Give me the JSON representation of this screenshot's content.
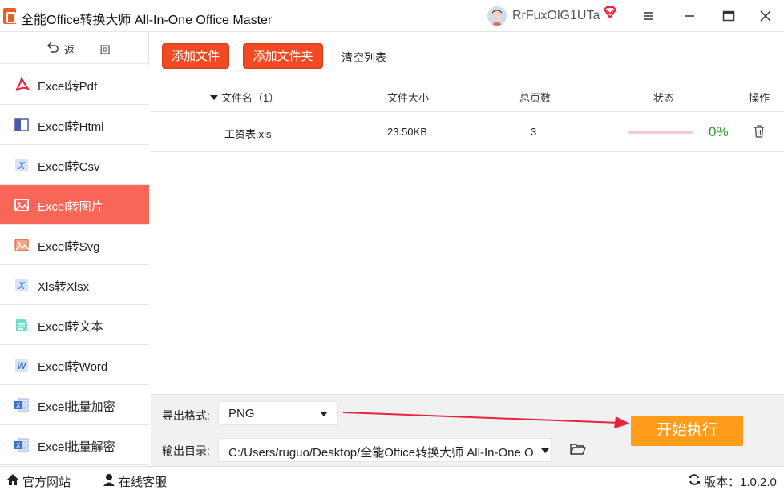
{
  "app": {
    "title": "全能Office转换大师 All-In-One Office Master",
    "user_name": "RrFuxOlG1UTa"
  },
  "colors": {
    "accent": "#f04a22",
    "sidebar_active": "#f86658",
    "start_button": "#ff9c1a",
    "progress_text": "#2a9d2a",
    "progress_track": "#f6c7d4"
  },
  "sidebar": {
    "back_label": "返 回",
    "items": [
      {
        "label": "Excel转Pdf",
        "icon": "pdf-icon",
        "active": false
      },
      {
        "label": "Excel转Html",
        "icon": "html-icon",
        "active": false
      },
      {
        "label": "Excel转Csv",
        "icon": "csv-icon",
        "active": false
      },
      {
        "label": "Excel转图片",
        "icon": "image-icon",
        "active": true
      },
      {
        "label": "Excel转Svg",
        "icon": "svg-image-icon",
        "active": false
      },
      {
        "label": "Xls转Xlsx",
        "icon": "xlsx-icon",
        "active": false
      },
      {
        "label": "Excel转文本",
        "icon": "text-file-icon",
        "active": false
      },
      {
        "label": "Excel转Word",
        "icon": "word-icon",
        "active": false
      },
      {
        "label": "Excel批量加密",
        "icon": "excel-lock-icon",
        "active": false
      },
      {
        "label": "Excel批量解密",
        "icon": "excel-unlock-icon",
        "active": false
      }
    ]
  },
  "toolbar": {
    "add_file": "添加文件",
    "add_folder": "添加文件夹",
    "clear_list": "清空列表"
  },
  "table": {
    "columns": [
      "文件名（1）",
      "文件大小",
      "总页数",
      "状态",
      "操作"
    ],
    "rows": [
      {
        "name": "工资表.xls",
        "size": "23.50KB",
        "pages": "3",
        "progress": 0,
        "progress_text": "0%"
      }
    ]
  },
  "bottom": {
    "format_label": "导出格式:",
    "format_value": "PNG",
    "output_label": "输出目录:",
    "output_value": "C:/Users/ruguo/Desktop/全能Office转换大师 All-In-One O",
    "start_label": "开始执行"
  },
  "statusbar": {
    "website": "官方网站",
    "support": "在线客服",
    "version": "版本：1.0.2.0"
  }
}
